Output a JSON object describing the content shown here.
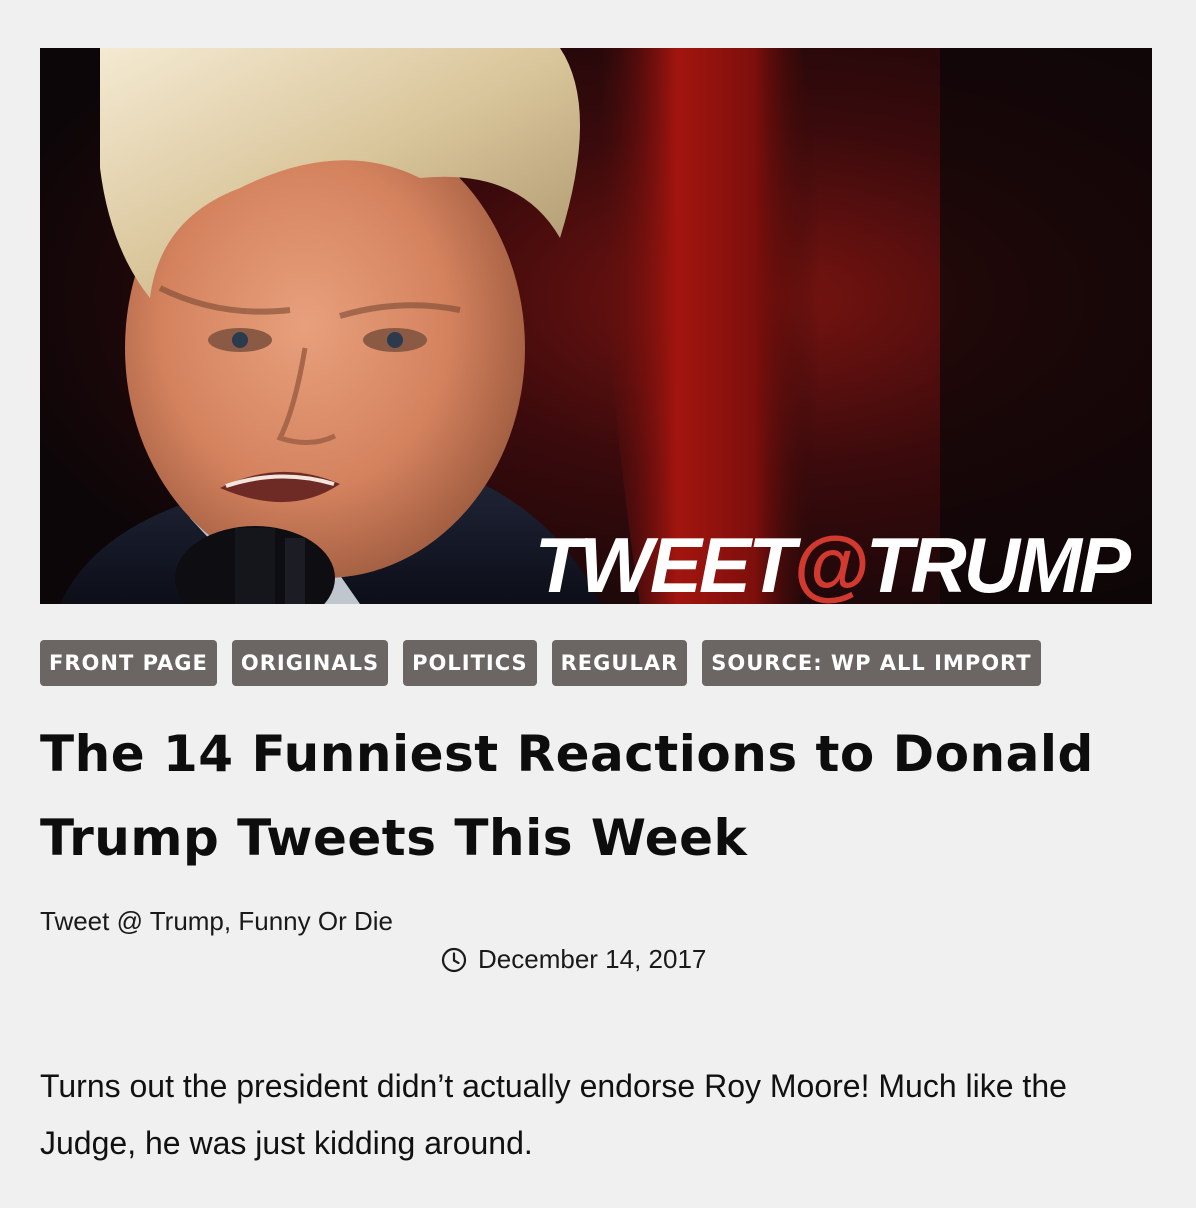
{
  "hero": {
    "logo_part1": "TWEET",
    "logo_at": "@",
    "logo_part2": "TRUMP",
    "colors": {
      "logo_text": "#ffffff",
      "logo_at": "#d23a2f",
      "background": "#1a0a0c"
    }
  },
  "tags": [
    {
      "label": "FRONT PAGE"
    },
    {
      "label": "ORIGINALS"
    },
    {
      "label": "POLITICS"
    },
    {
      "label": "REGULAR"
    },
    {
      "label": "SOURCE: WP ALL IMPORT"
    }
  ],
  "article": {
    "title": "The 14 Funniest Reactions to Donald Trump Tweets This Week",
    "byline_author1": "Tweet @ Trump",
    "byline_separator": ", ",
    "byline_author2": "Funny Or Die",
    "date": "December 14, 2017",
    "date_icon": "clock-icon",
    "body": "Turns out the president didn’t actually endorse Roy Moore! Much like the Judge, he was just kidding around."
  },
  "colors": {
    "page_background": "#f0f0f0",
    "tag_background": "#6b6564",
    "tag_text": "#ffffff",
    "text": "#111111"
  }
}
